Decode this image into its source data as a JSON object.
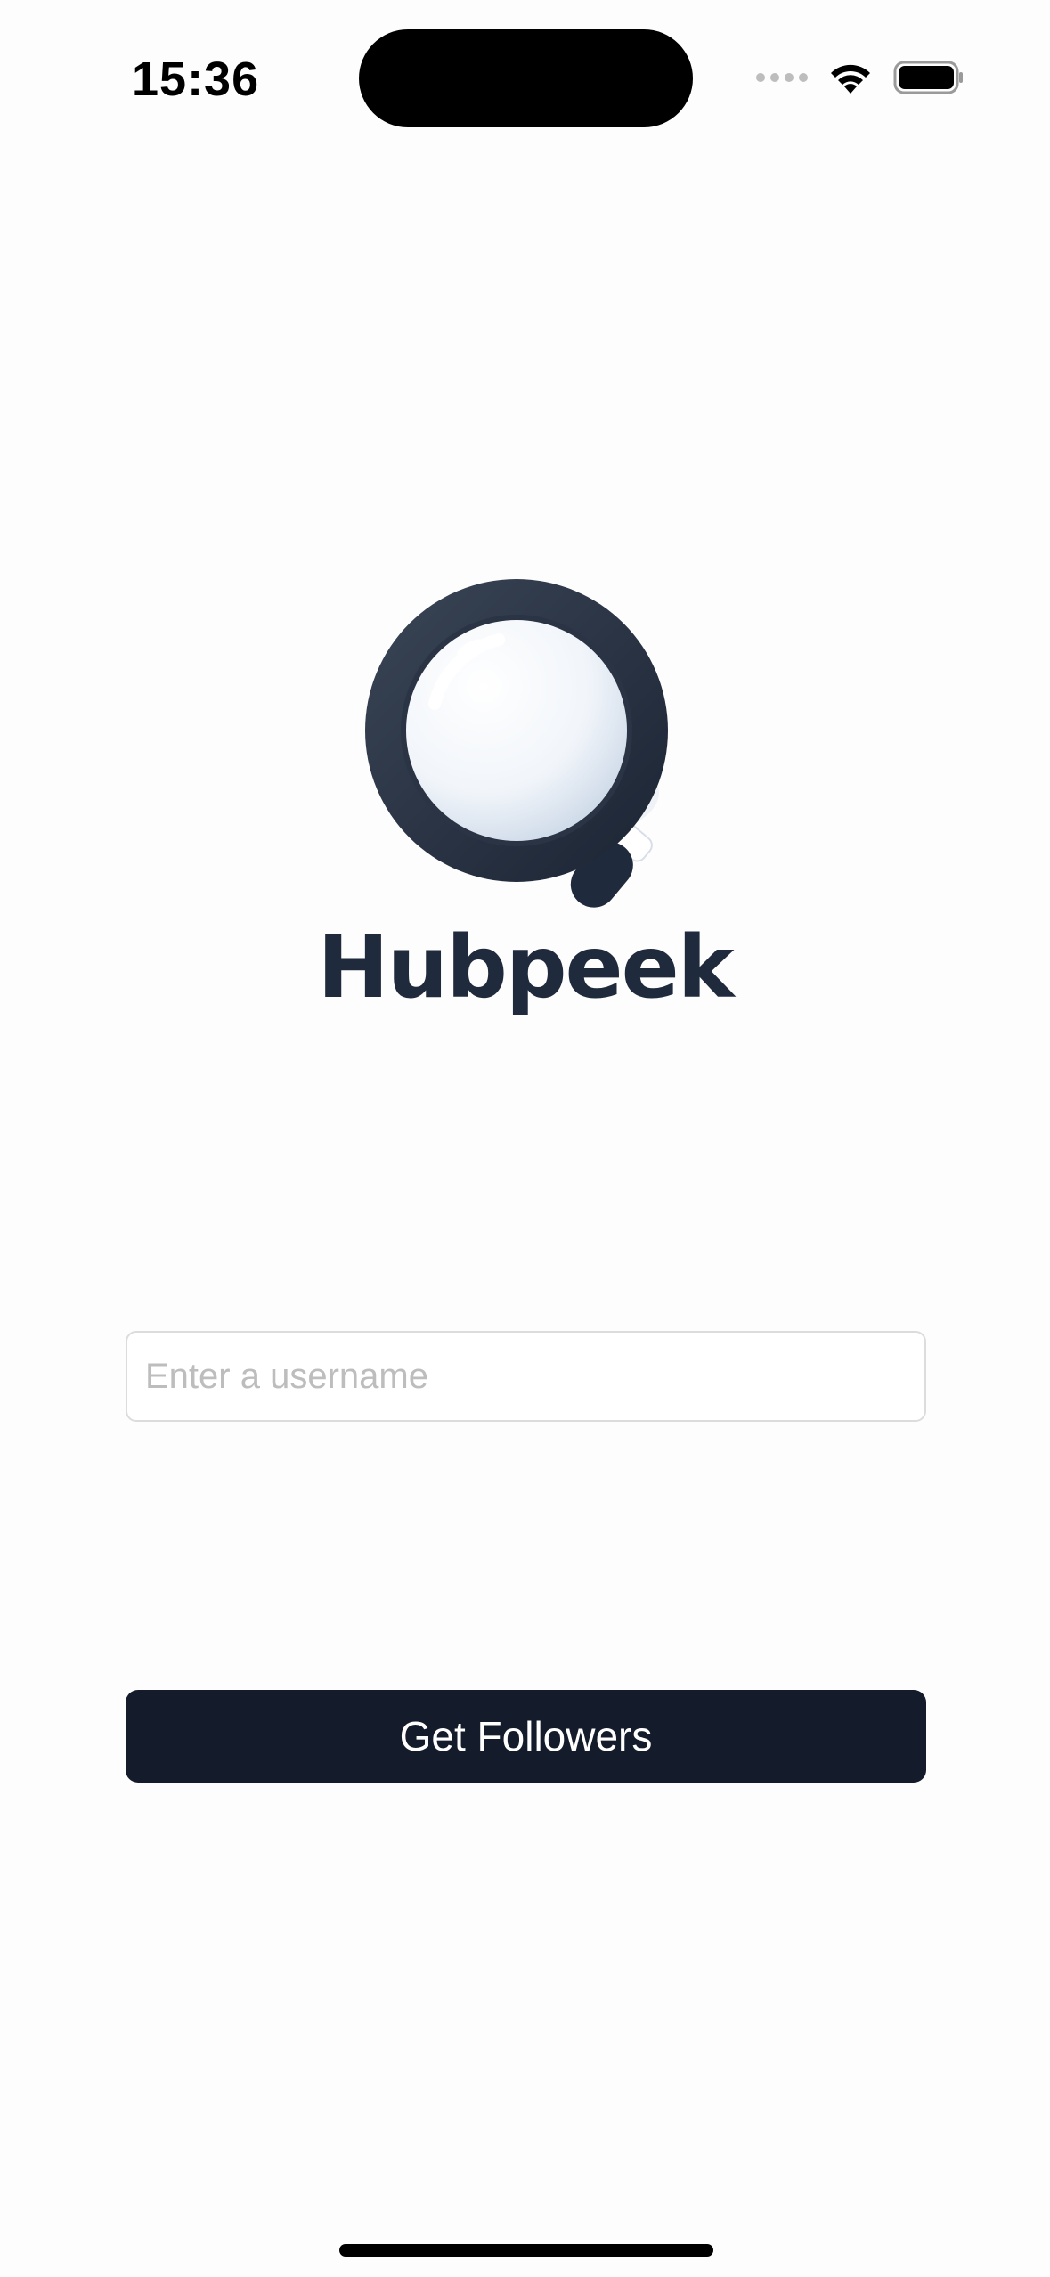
{
  "status_bar": {
    "time": "15:36"
  },
  "brand": {
    "name": "Hubpeek",
    "logo_icon": "magnifying-glass-icon",
    "color": "#1F2A3C"
  },
  "form": {
    "username_placeholder": "Enter a username",
    "username_value": "",
    "submit_label": "Get Followers"
  },
  "colors": {
    "button_bg": "#141C2B",
    "button_text": "#FFFFFF",
    "background": "#FDFDFD"
  }
}
